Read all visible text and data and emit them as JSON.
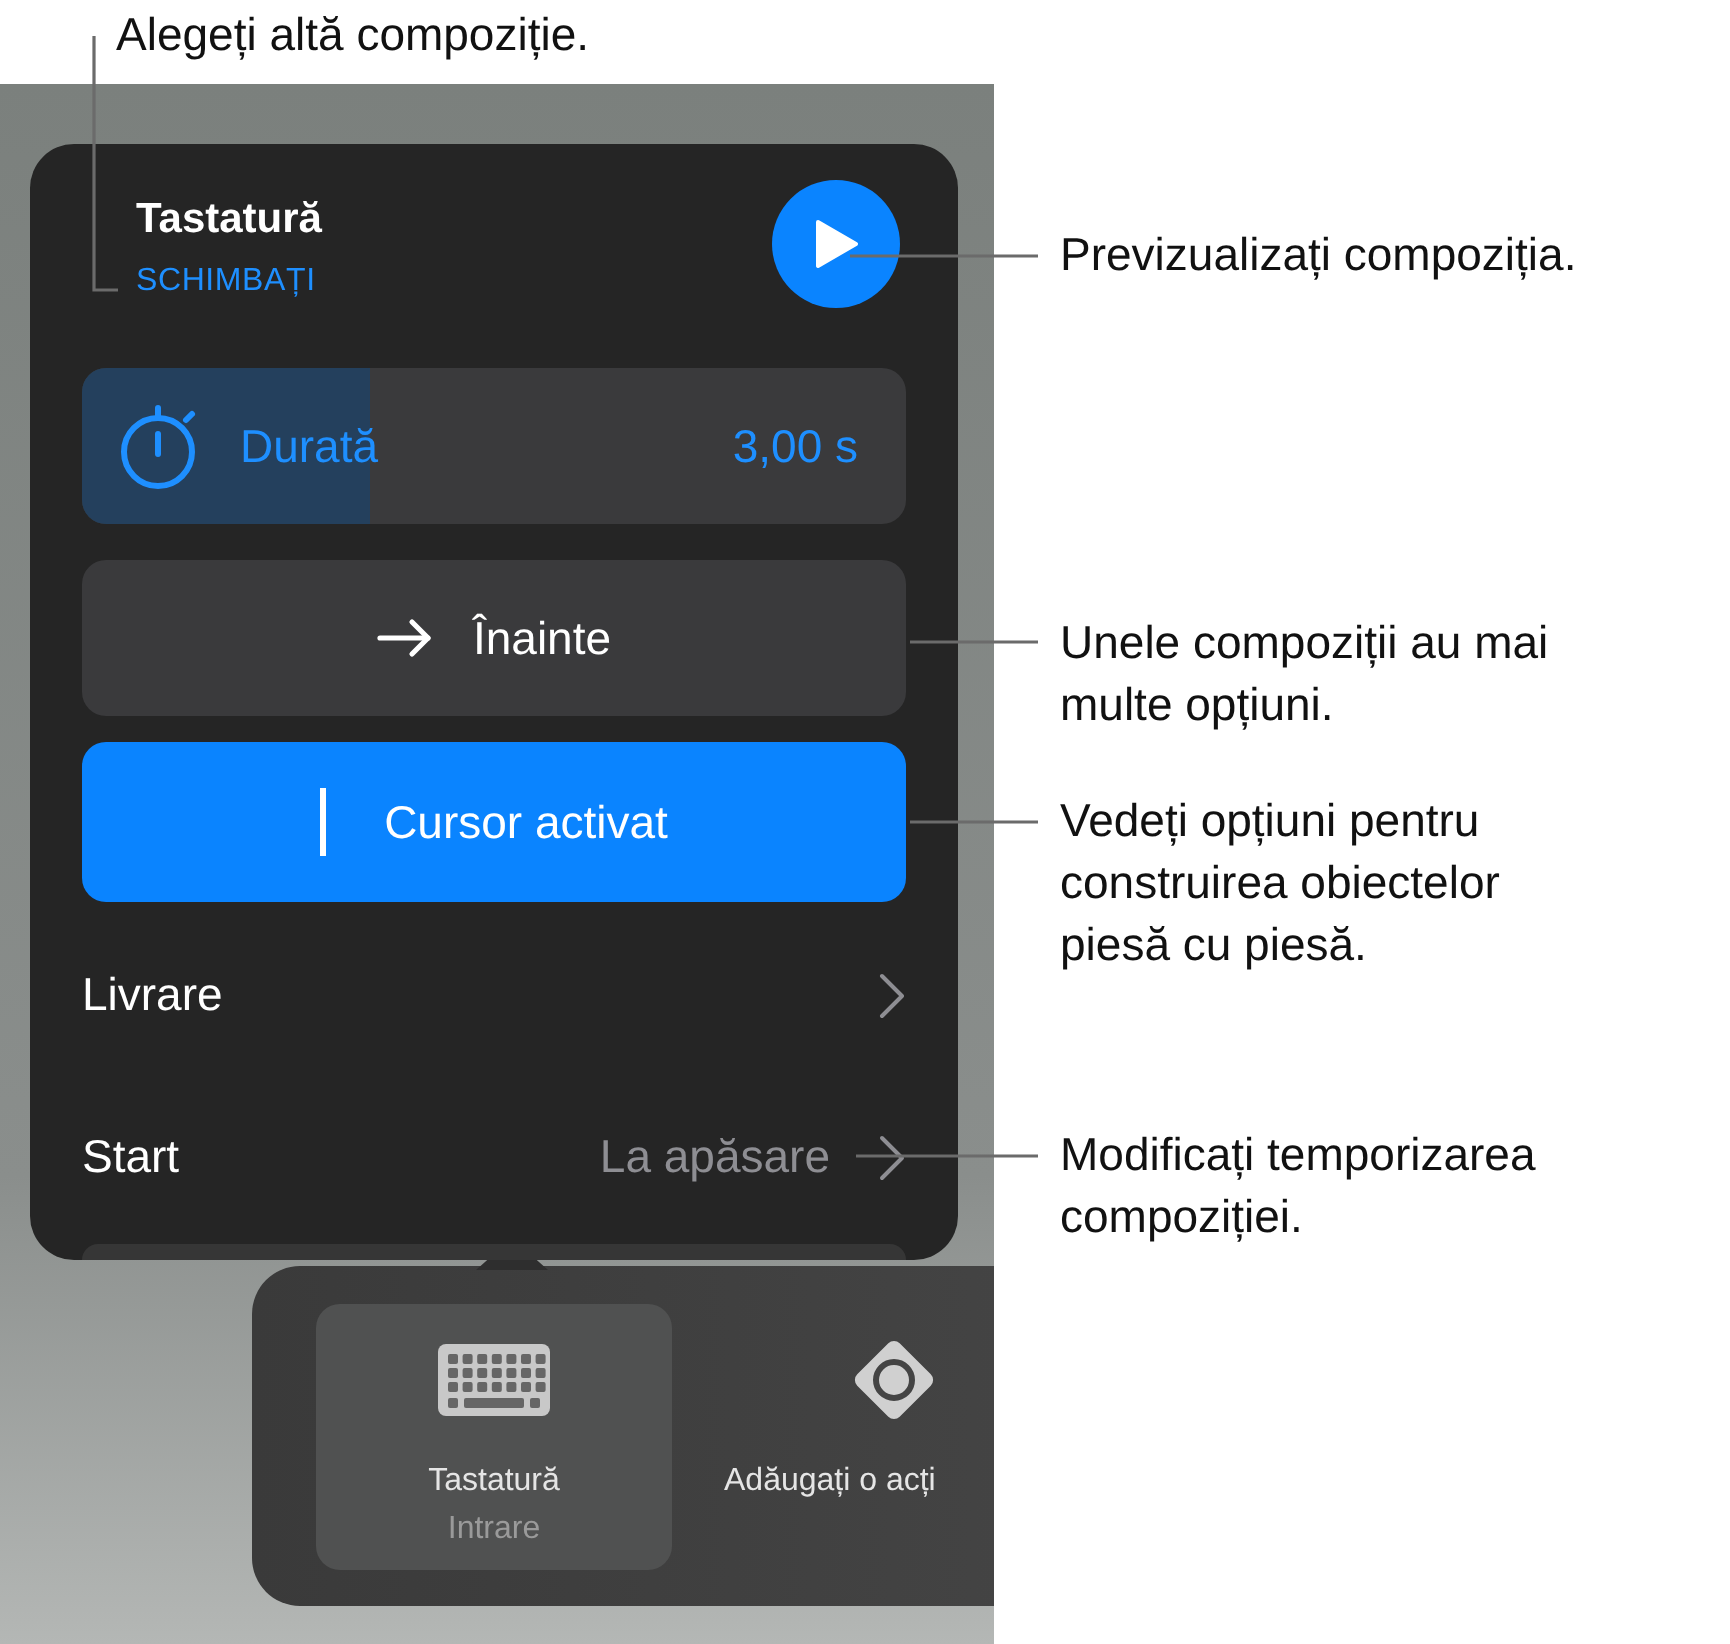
{
  "callouts": [
    {
      "lines": [
        "Alegeți altă compoziție."
      ]
    },
    {
      "lines": [
        "Previzualizați compoziția."
      ]
    },
    {
      "lines": [
        "Unele compoziții au mai",
        "multe opțiuni."
      ]
    },
    {
      "lines": [
        "Vedeți opțiuni pentru",
        "construirea obiectelor",
        "piesă cu piesă."
      ]
    },
    {
      "lines": [
        "Modificați temporizarea",
        "compoziției."
      ]
    }
  ],
  "popover": {
    "title": "Tastatură",
    "change_link": "SCHIMBAȚI",
    "duration": {
      "label": "Durată",
      "value": "3,00 s",
      "level": 0.35
    },
    "option_buttons": [
      {
        "kind": "direction",
        "label": "Înainte",
        "selected": false
      },
      {
        "kind": "cursor",
        "label": "Cursor activat",
        "selected": true
      }
    ],
    "rows": [
      {
        "label": "Livrare"
      },
      {
        "label": "Start",
        "value": "La apăsare"
      }
    ]
  },
  "toolbar": {
    "items": [
      {
        "kind": "keyboard",
        "label": "Tastatură",
        "sublabel": "Intrare",
        "selected": true
      },
      {
        "kind": "action",
        "label": "Adăugați o acți",
        "selected": false
      }
    ]
  }
}
